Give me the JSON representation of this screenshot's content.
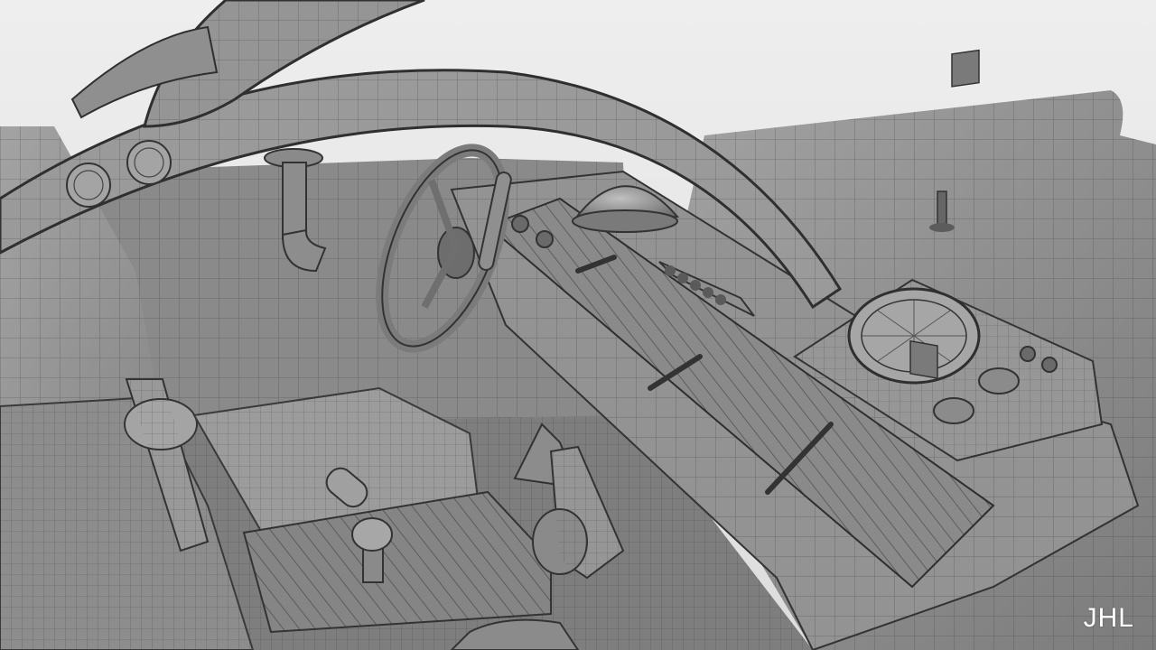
{
  "render": {
    "subject": "car-interior-wireframe-render",
    "colors": {
      "sky": "#e9e9e9",
      "body": "#8f8f8f",
      "body_light": "#a6a6a6",
      "body_dark": "#5f5f5f",
      "wire": "#3b3b3b",
      "watermark": "#ffffff"
    }
  },
  "watermark": {
    "text": "JHL"
  }
}
